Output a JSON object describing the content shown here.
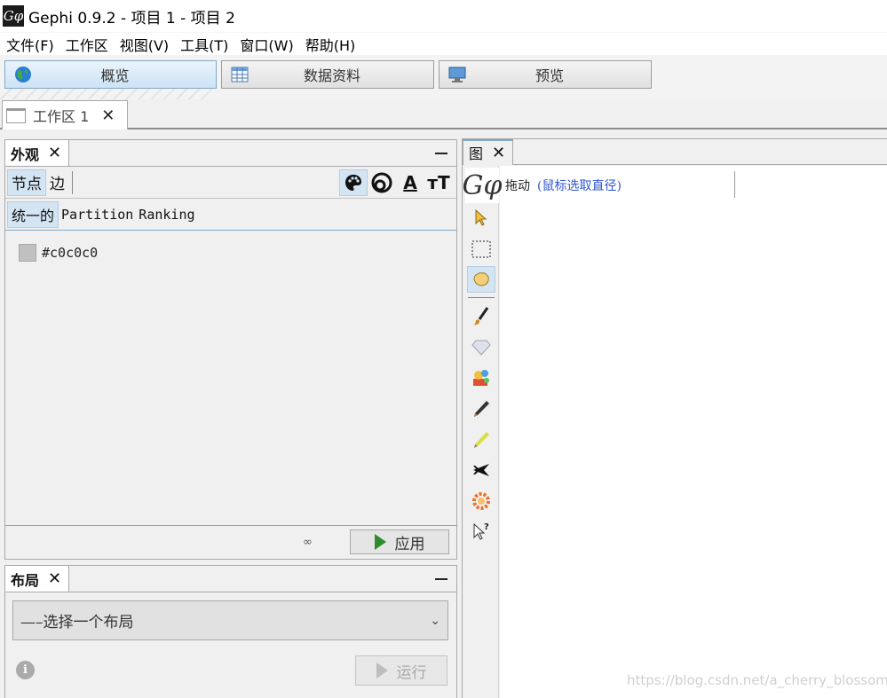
{
  "window": {
    "title": "Gephi 0.9.2 - 项目 1 - 项目 2",
    "app_icon_text": "Gφ"
  },
  "menu": [
    "文件(F)",
    "工作区",
    "视图(V)",
    "工具(T)",
    "窗口(W)",
    "帮助(H)"
  ],
  "modes": [
    {
      "label": "概览",
      "icon": "globe-icon",
      "active": true
    },
    {
      "label": "数据资料",
      "icon": "table-icon",
      "active": false
    },
    {
      "label": "预览",
      "icon": "monitor-icon",
      "active": false
    }
  ],
  "workspace_tab": {
    "label": "工作区 1",
    "close": "✕"
  },
  "appearance": {
    "title": "外观",
    "close": "✕",
    "segments": [
      "节点",
      "边"
    ],
    "tool_icons": {
      "color": "palette-icon",
      "size": "size-icon",
      "label_color": "A",
      "label_size": "тT"
    },
    "mode_tabs": [
      "统一的",
      "Partition",
      "Ranking"
    ],
    "color": {
      "value": "#c0c0c0",
      "swatch": "#c0c0c0"
    },
    "chain": "∞",
    "apply_label": "应用"
  },
  "layout": {
    "title": "布局",
    "close": "✕",
    "select_value": "—–选择一个布局",
    "chevron": "⌄",
    "info": "i",
    "run_label": "运行"
  },
  "graph": {
    "title": "图",
    "close": "✕",
    "logo": "Gφ",
    "drag_label": "拖动",
    "drag_hint": "(鼠标选取直径)",
    "tools": [
      "pointer-icon",
      "rect-select-icon",
      "drag-hand-icon",
      "brush-icon",
      "diamond-icon",
      "painter-icon",
      "pencil-icon",
      "highlighter-icon",
      "plane-icon",
      "flower-icon",
      "help-pointer-icon"
    ]
  },
  "watermark": "https://blog.csdn.net/a_cherry_blossoms"
}
